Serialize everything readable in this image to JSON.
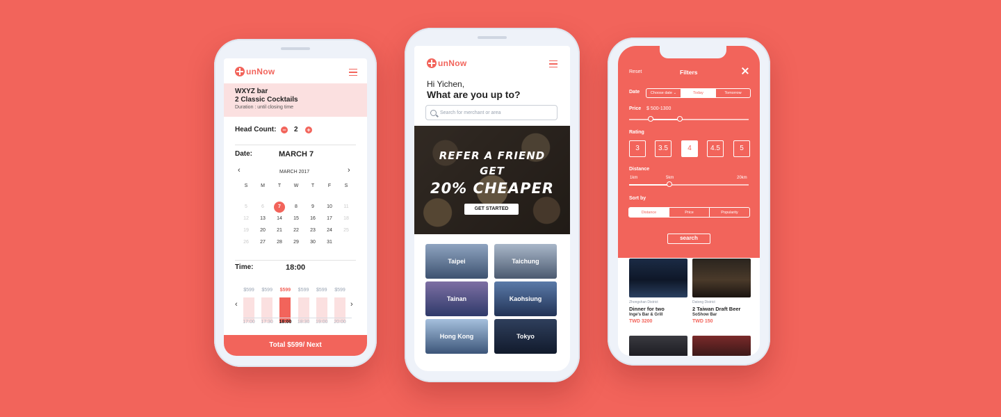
{
  "brand": {
    "name": "unNow",
    "color": "#f2645b"
  },
  "booking": {
    "venue": "WXYZ bar",
    "deal": "2 Classic Cocktails",
    "duration": "Duration : until closing time",
    "head_count_label": "Head Count:",
    "head_count": "2",
    "minus": "−",
    "plus": "+",
    "date_label": "Date:",
    "date_value": "MARCH 7",
    "cal_prev": "‹",
    "cal_next": "›",
    "calendar_month": "MARCH 2017",
    "weekdays": [
      "S",
      "M",
      "T",
      "W",
      "T",
      "F",
      "S"
    ],
    "weeks": [
      [
        "5",
        "6",
        "7",
        "8",
        "9",
        "10",
        "11"
      ],
      [
        "12",
        "13",
        "14",
        "15",
        "16",
        "17",
        "18"
      ],
      [
        "19",
        "20",
        "21",
        "22",
        "23",
        "24",
        "25"
      ],
      [
        "26",
        "27",
        "28",
        "29",
        "30",
        "31",
        ""
      ]
    ],
    "selected_day": "7",
    "time_label": "Time:",
    "time_value": "18:00",
    "slots": [
      {
        "price": "$599",
        "time": "17:00"
      },
      {
        "price": "$599",
        "time": "17:30"
      },
      {
        "price": "$599",
        "time": "18:00",
        "active": true
      },
      {
        "price": "$599",
        "time": "18:30"
      },
      {
        "price": "$599",
        "time": "19:00"
      },
      {
        "price": "$599",
        "time": "20:00"
      }
    ],
    "slot_prev": "‹",
    "slot_next": "›",
    "cta": "Total $599/ Next"
  },
  "home": {
    "greeting": "Hi Yichen,",
    "question": "What are you up to?",
    "search_placeholder": "Search for merchant or area",
    "banner_line1": "REFER A FRIEND",
    "banner_line2": "GET",
    "banner_line3": "20% CHEAPER",
    "banner_button": "GET STARTED",
    "cities": [
      "Taipei",
      "Taichung",
      "Tainan",
      "Kaohsiung",
      "Hong Kong",
      "Tokyo"
    ]
  },
  "filters": {
    "reset": "Reset",
    "title": "Filters",
    "date_label": "Date",
    "date_options": [
      "Choose date ⌄",
      "Today",
      "Tomorrow"
    ],
    "date_selected": "Today",
    "price_label": "Price",
    "price_value": "$ 500-1300",
    "rating_label": "Rating",
    "ratings": [
      "3",
      "3.5",
      "4",
      "4.5",
      "5"
    ],
    "rating_selected": "4",
    "distance_label": "Distance",
    "distance_marks": [
      "1km",
      "5km",
      "20km"
    ],
    "sort_label": "Sort by",
    "sort_options": [
      "Distance",
      "Price",
      "Popularity"
    ],
    "sort_selected": "Distance",
    "search_button": "search"
  },
  "listings": [
    {
      "district": "Zhongshan District",
      "title": "Dinner for two",
      "venue": "Inge's Bar & Grill",
      "price": "TWD 3200"
    },
    {
      "district": "Datong District",
      "title": "2 Taiwan Draft Beer",
      "venue": "SoShow Bar",
      "price": "TWD 150"
    }
  ]
}
